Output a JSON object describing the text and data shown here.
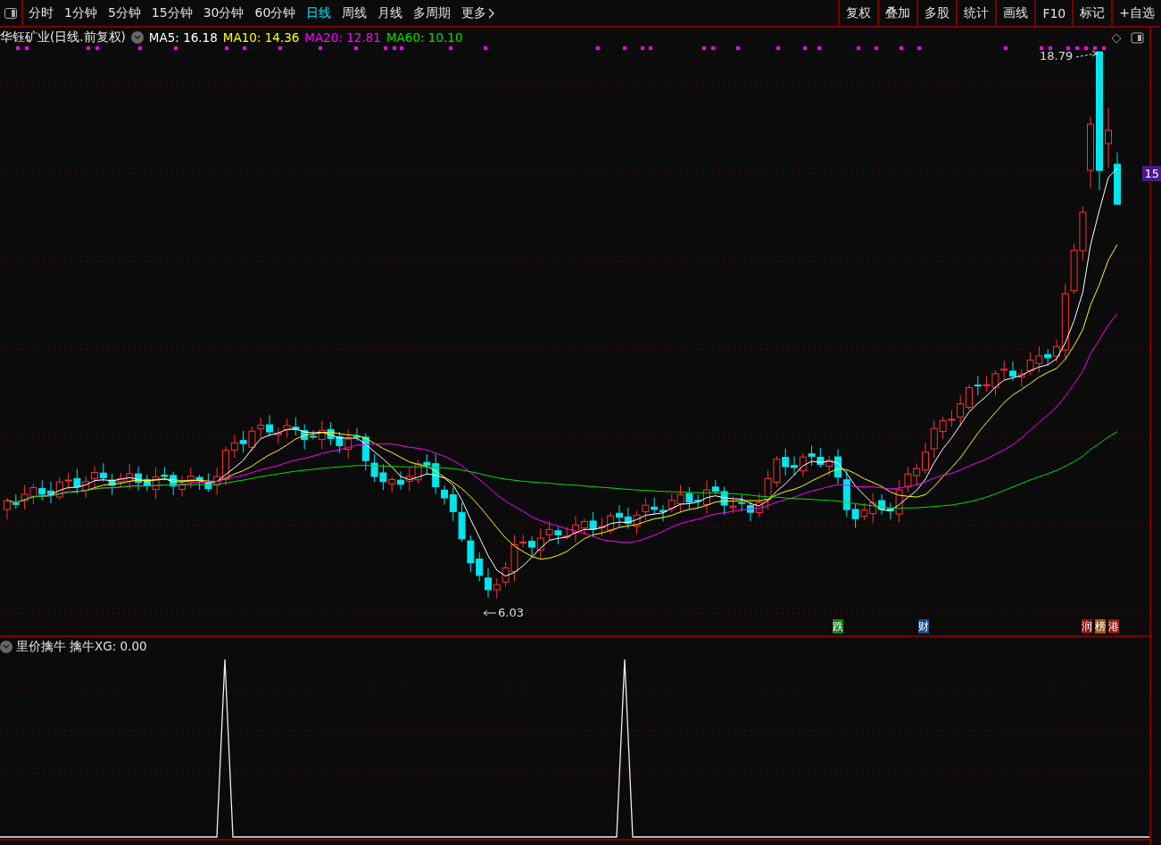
{
  "toolbar": {
    "periods": [
      {
        "label": "分时",
        "selected": false
      },
      {
        "label": "1分钟",
        "selected": false
      },
      {
        "label": "5分钟",
        "selected": false
      },
      {
        "label": "15分钟",
        "selected": false
      },
      {
        "label": "30分钟",
        "selected": false
      },
      {
        "label": "60分钟",
        "selected": false
      },
      {
        "label": "日线",
        "selected": true
      },
      {
        "label": "周线",
        "selected": false
      },
      {
        "label": "月线",
        "selected": false
      },
      {
        "label": "多周期",
        "selected": false
      }
    ],
    "more": "更多",
    "tools": [
      "复权",
      "叠加",
      "多股",
      "统计",
      "画线",
      "F10",
      "标记",
      "+自选"
    ]
  },
  "main_chart": {
    "title": "华钰矿业(日线.前复权)",
    "moving_averages": [
      {
        "label": "MA5: 16.18",
        "color": "#ffffff"
      },
      {
        "label": "MA10: 14.36",
        "color": "#ffff00"
      },
      {
        "label": "MA20: 12.81",
        "color": "#ff00ff"
      },
      {
        "label": "MA60: 10.10",
        "color": "#00e000"
      }
    ],
    "high_marker": "18.79",
    "low_marker": "6.03",
    "price_tag": "15",
    "events": [
      {
        "label": "跌",
        "color": "#17801a"
      },
      {
        "label": "财",
        "color": "#1b4c80"
      },
      {
        "label": "润",
        "color": "#8c1414"
      },
      {
        "label": "榜",
        "color": "#9a5a10"
      },
      {
        "label": "港",
        "color": "#8c1414"
      }
    ]
  },
  "indicator": {
    "name": "里价擒牛",
    "reading": "擒牛XG: 0.00"
  }
}
